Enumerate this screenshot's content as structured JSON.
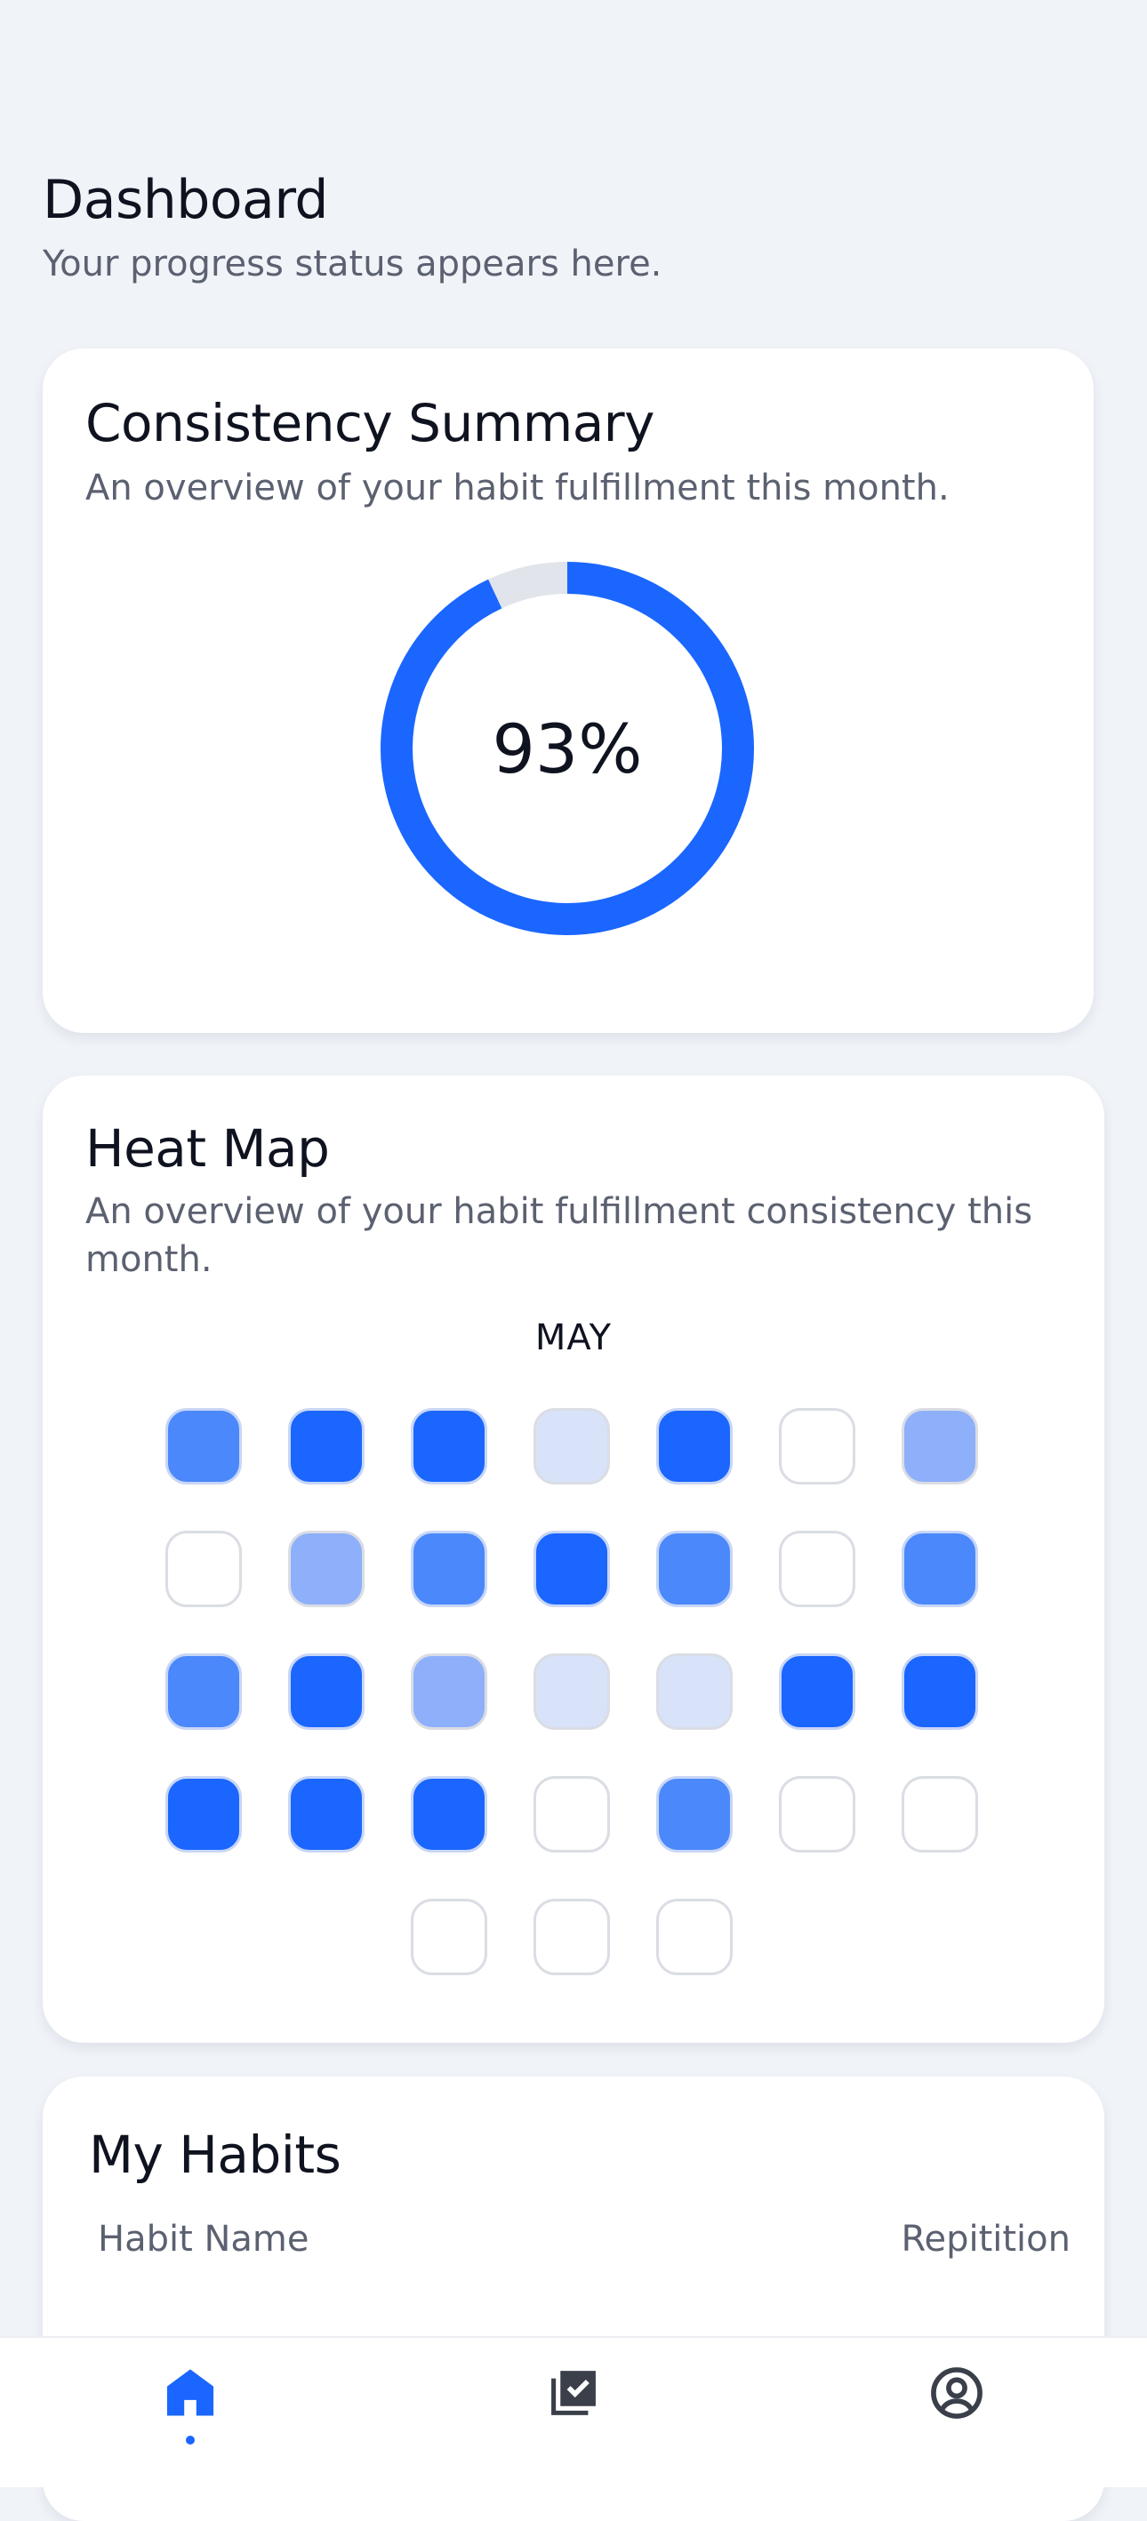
{
  "header": {
    "title": "Dashboard",
    "subtitle": "Your progress status appears here."
  },
  "summary": {
    "title": "Consistency Summary",
    "description": "An overview of your habit fulfillment this month.",
    "percent_label": "93%",
    "percent_value": 93,
    "ring_color": "#1a66ff",
    "ring_track_color": "#e1e4ea"
  },
  "heatmap": {
    "title": "Heat Map",
    "description": "An overview of your habit fulfillment consistency this month.",
    "month": "MAY",
    "levels": [
      3,
      4,
      4,
      1,
      4,
      0,
      2,
      0,
      2,
      3,
      4,
      3,
      0,
      3,
      3,
      4,
      2,
      1,
      1,
      4,
      4,
      4,
      4,
      4,
      0,
      3,
      0,
      0,
      0,
      0,
      0
    ],
    "level_colors": [
      "#ffffff",
      "#d8e3fa",
      "#8eb0fb",
      "#4a88fb",
      "#1a66ff"
    ]
  },
  "habits": {
    "title": "My Habits",
    "col_name": "Habit Name",
    "col_repetition": "Repitition"
  },
  "nav": {
    "items": [
      {
        "name": "home",
        "icon": "home-icon",
        "active": true
      },
      {
        "name": "habits",
        "icon": "checklist-icon",
        "active": false
      },
      {
        "name": "profile",
        "icon": "profile-icon",
        "active": false
      }
    ],
    "active_color": "#1a66ff",
    "inactive_color": "#3a3f4a"
  }
}
